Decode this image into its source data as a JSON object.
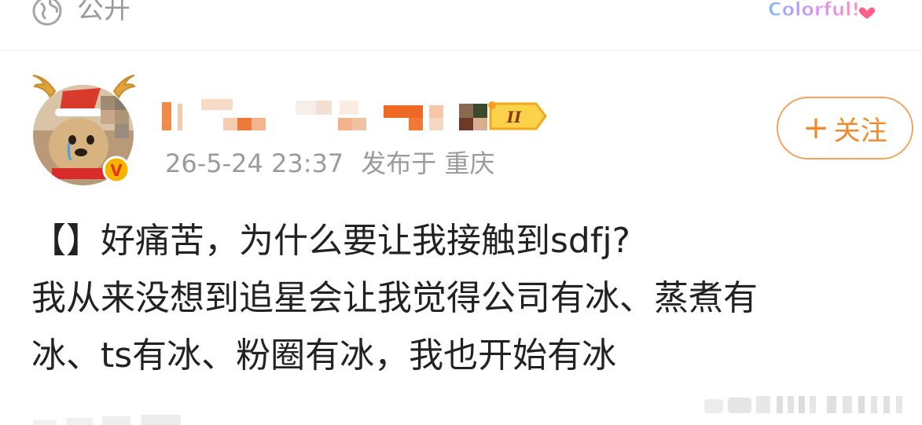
{
  "top_bar": {
    "visibility_icon": "globe-icon",
    "visibility_label": "公开",
    "decoration_text": "Colorful!"
  },
  "header": {
    "avatar_icon": "reindeer-dog-avatar",
    "verified_badge": "V",
    "level_badge": "II",
    "timestamp": "26-5-24 23:37",
    "location": "发布于 重庆",
    "follow_label": "关注",
    "follow_icon": "plus-icon"
  },
  "post": {
    "lines": [
      "【】好痛苦，为什么要让我接触到sdfj?",
      "我从来没想到追星会让我觉得公司有冰、蒸煮有",
      "冰、ts有冰、粉圈有冰，我也开始有冰"
    ]
  },
  "colors": {
    "accent": "#f08a2c",
    "muted_text": "#9b9b9b",
    "body_text": "#222222"
  }
}
